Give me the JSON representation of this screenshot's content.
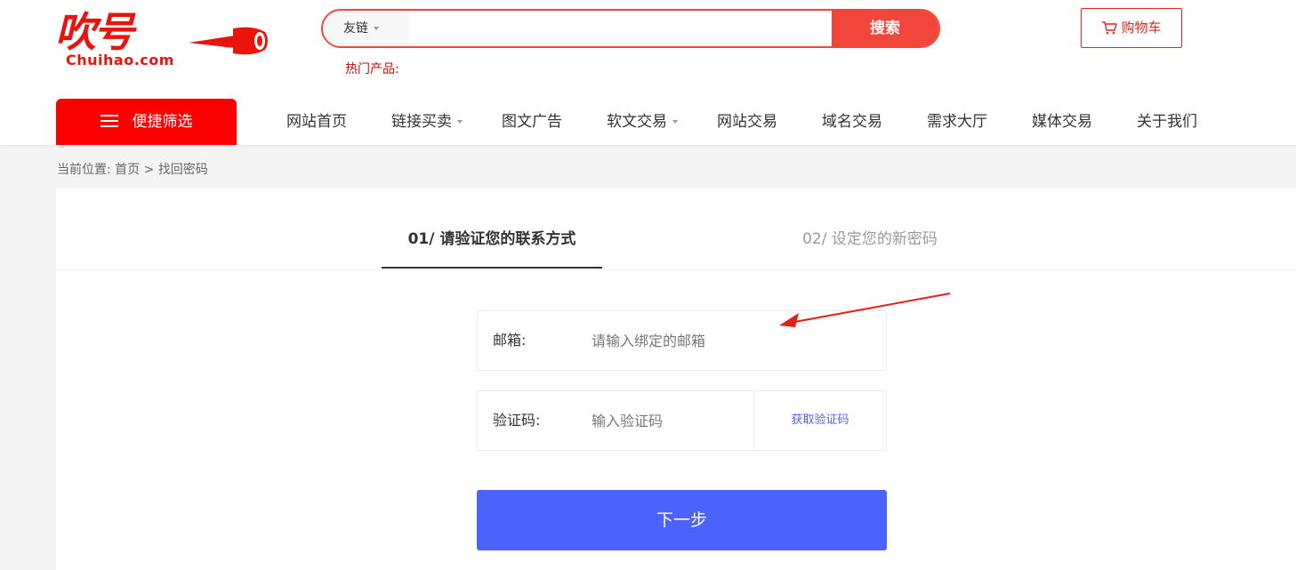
{
  "logo": {
    "text_cn": "吹号",
    "text_en": "Chuihao.com"
  },
  "search": {
    "category": "友链",
    "placeholder": "",
    "button": "搜索",
    "hot_label": "热门产品:"
  },
  "cart": {
    "label": "购物车"
  },
  "nav": {
    "quick_filter": "便捷筛选",
    "items": [
      "网站首页",
      "链接买卖",
      "图文广告",
      "软文交易",
      "网站交易",
      "域名交易",
      "需求大厅",
      "媒体交易",
      "关于我们"
    ]
  },
  "breadcrumb": {
    "prefix": "当前位置:",
    "home": "首页",
    "sep": ">",
    "current": "找回密码"
  },
  "tabs": {
    "step1": "01/ 请验证您的联系方式",
    "step2": "02/ 设定您的新密码"
  },
  "form": {
    "email_label": "邮箱:",
    "email_placeholder": "请输入绑定的邮箱",
    "code_label": "验证码:",
    "code_placeholder": "输入验证码",
    "get_code": "获取验证码",
    "next": "下一步"
  },
  "colors": {
    "brand_red": "#e8140d",
    "quick_red": "#fa0000",
    "primary_blue": "#4c63fb",
    "link_blue": "#4e67d8"
  }
}
